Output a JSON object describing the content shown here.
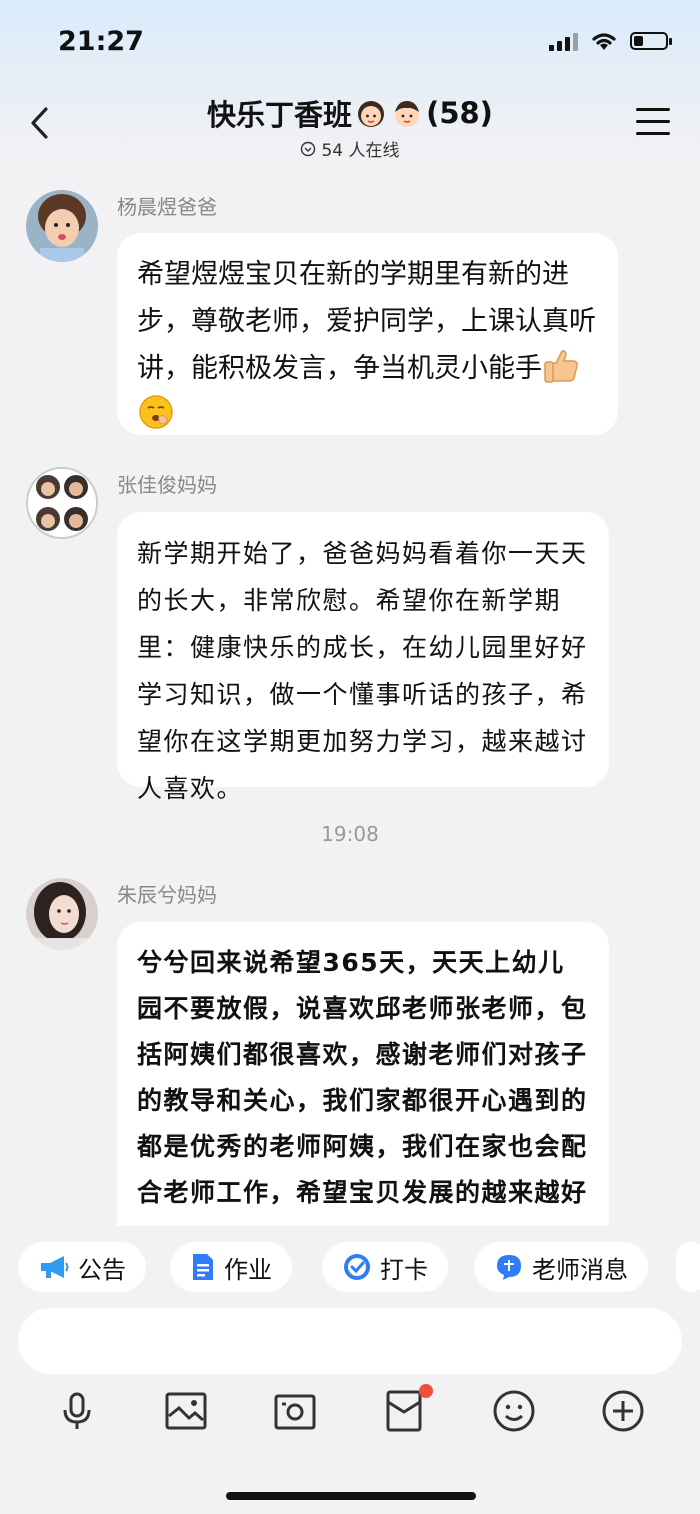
{
  "status": {
    "time": "21:27"
  },
  "header": {
    "title": "快乐丁香班",
    "member_count": "(58)",
    "online": "54 人在线"
  },
  "messages": [
    {
      "sender": "杨晨煜爸爸",
      "text": "  希望煜煜宝贝在新的学期里有新的进步，尊敬老师，爱护同学，上课认真听讲，能积极发言，争当机灵小能手",
      "emoji": [
        "thumbs-up",
        "yawning-face"
      ]
    },
    {
      "sender": "张佳俊妈妈",
      "text": "新学期开始了，爸爸妈妈看着你一天天的长大，非常欣慰。希望你在新学期里：健康快乐的成长，在幼儿园里好好学习知识，做一个懂事听话的孩子，希望你在这学期更加努力学习，越来越讨人喜欢。"
    },
    {
      "sender": "朱辰兮妈妈",
      "text": "兮兮回来说希望365天，天天上幼儿园不要放假，说喜欢邱老师张老师，包括阿姨们都很喜欢，感谢老师们对孩子的教导和关心，我们家都很开心遇到的都是优秀的老师阿姨，我们在家也会配合老师工作，希望宝贝发展的越来越好"
    }
  ],
  "time_separator": "19:08",
  "quick_actions": [
    {
      "label": "公告",
      "icon": "megaphone-icon"
    },
    {
      "label": "作业",
      "icon": "document-icon"
    },
    {
      "label": "打卡",
      "icon": "checkin-icon"
    },
    {
      "label": "老师消息",
      "icon": "teacher-message-icon"
    }
  ],
  "toolbar": {
    "icons": [
      "microphone-icon",
      "image-icon",
      "camera-icon",
      "red-packet-icon",
      "emoji-icon",
      "plus-icon"
    ]
  },
  "colors": {
    "accent": "#2f7cf6",
    "notification": "#f0503a"
  }
}
